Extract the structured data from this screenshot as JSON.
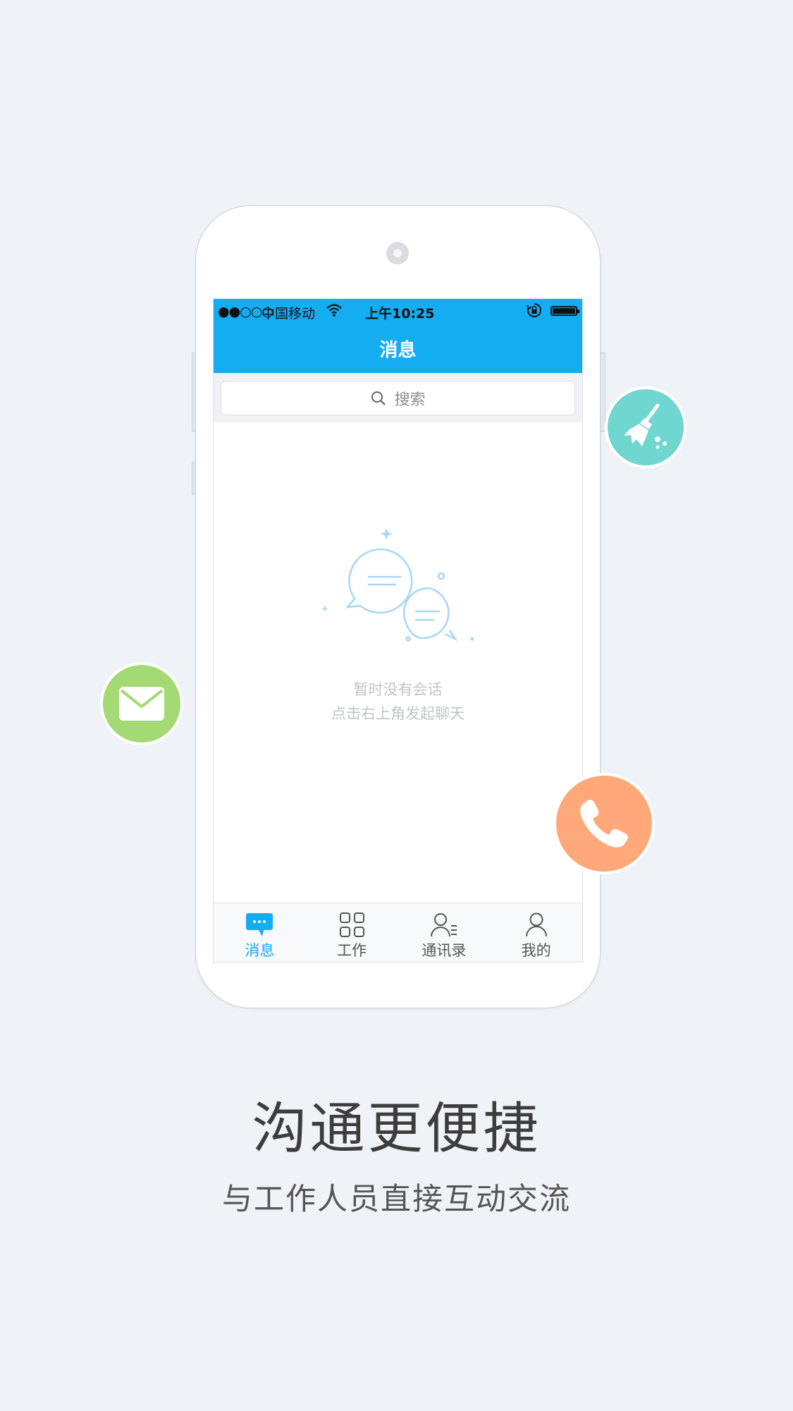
{
  "statusbar": {
    "signal": "●●○○○",
    "carrier": "中国移动",
    "time": "上午10:25"
  },
  "navbar": {
    "title": "消息"
  },
  "search": {
    "placeholder": "搜索"
  },
  "empty": {
    "line1": "暂时没有会话",
    "line2": "点击右上角发起聊天"
  },
  "tabbar": {
    "items": [
      {
        "label": "消息",
        "icon": "chat-icon",
        "active": true
      },
      {
        "label": "工作",
        "icon": "grid-icon",
        "active": false
      },
      {
        "label": "通讯录",
        "icon": "contacts-icon",
        "active": false
      },
      {
        "label": "我的",
        "icon": "profile-icon",
        "active": false
      }
    ]
  },
  "floating_icons": [
    {
      "icon": "broom-icon",
      "color": "#6fd6d0"
    },
    {
      "icon": "mail-icon",
      "color": "#a3da74"
    },
    {
      "icon": "phone-icon",
      "color": "#ffa87a"
    }
  ],
  "colors": {
    "accent": "#14adf1",
    "background": "#eff3f7"
  },
  "promo": {
    "headline": "沟通更便捷",
    "subline": "与工作人员直接互动交流"
  }
}
